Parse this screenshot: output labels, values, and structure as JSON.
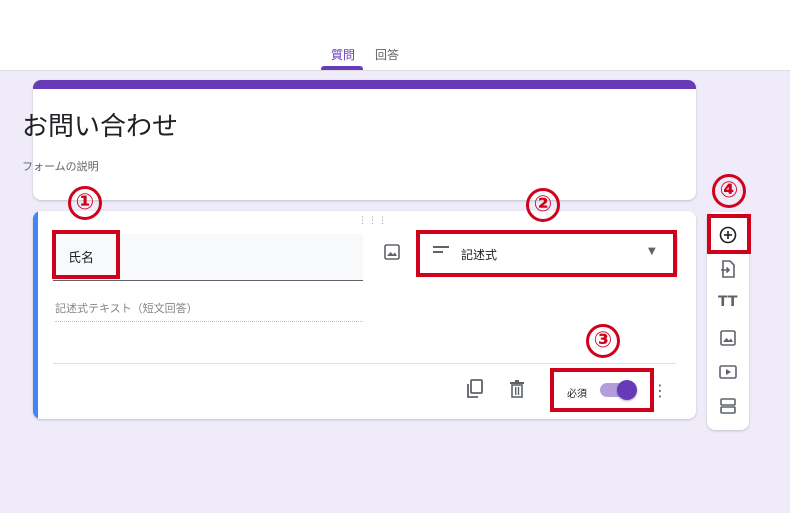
{
  "tabs": [
    {
      "label": "質問",
      "active": true
    },
    {
      "label": "回答",
      "active": false
    }
  ],
  "form": {
    "title": "お問い合わせ",
    "description": "フォームの説明"
  },
  "question": {
    "text": "氏名",
    "type": "記述式",
    "answer_hint": "記述式テキスト（短文回答）",
    "required_label": "必須",
    "required": true
  },
  "toolbar": {
    "text_icon_glyph": "TT"
  },
  "annotations": [
    "①",
    "②",
    "③",
    "④"
  ],
  "colors": {
    "accent": "#673ab7",
    "question_bar": "#4285f4",
    "highlight": "#d0021b",
    "background": "#efebf8"
  },
  "icons": [
    "image-icon",
    "short-text-icon",
    "dropdown-arrow-icon",
    "copy-icon",
    "trash-icon",
    "more-vert-icon",
    "add-circle-icon",
    "import-question-icon",
    "title-text-icon",
    "add-image-icon",
    "add-video-icon",
    "add-section-icon"
  ]
}
